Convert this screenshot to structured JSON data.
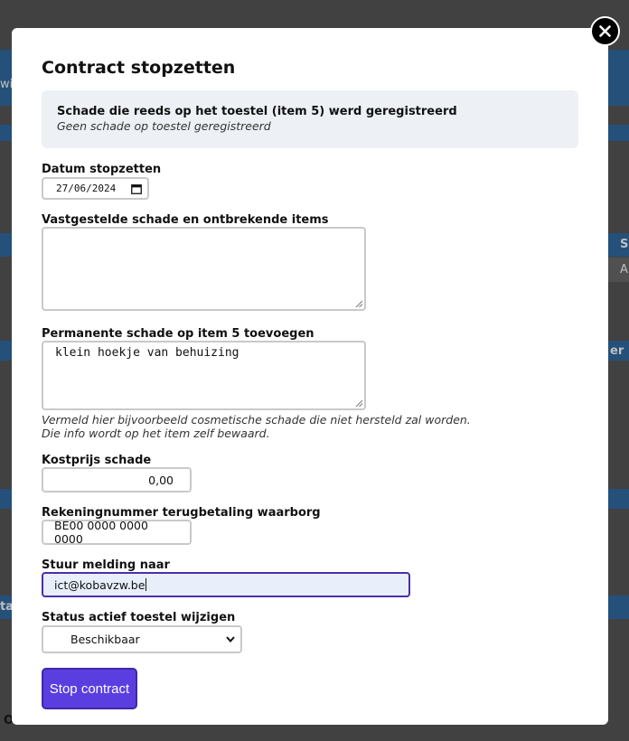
{
  "modal": {
    "title": "Contract stopzetten",
    "info": {
      "title": "Schade die reeds op het toestel (item 5) werd geregistreerd",
      "subtitle": "Geen schade op toestel geregistreerd"
    },
    "fields": {
      "stop_date": {
        "label": "Datum stopzetten",
        "value": "27/06/2024"
      },
      "damage": {
        "label": "Vastgestelde schade en ontbrekende items",
        "value": ""
      },
      "permanent_damage": {
        "label": "Permanente schade op item 5 toevoegen",
        "value": "klein hoekje van behuizing",
        "hint_line1": "Vermeld hier bijvoorbeeld cosmetische schade die niet hersteld zal worden.",
        "hint_line2": "Die info wordt op het item zelf bewaard."
      },
      "damage_cost": {
        "label": "Kostprijs schade",
        "value": "0,00"
      },
      "iban": {
        "label": "Rekeningnummer terugbetaling waarborg",
        "value": "BE00 0000 0000 0000"
      },
      "notify": {
        "label": "Stuur melding naar",
        "value": "ict@kobavzw.be"
      },
      "status": {
        "label": "Status actief toestel wijzigen",
        "selected": "Beschikbaar"
      }
    },
    "submit_label": "Stop contract"
  },
  "background": {
    "fragments": [
      "wi",
      "S",
      "A",
      "er",
      "ta"
    ],
    "footer_fragment": "O"
  },
  "icons": {
    "close": "close-icon",
    "calendar": "calendar-icon",
    "chevron": "chevron-down-icon"
  },
  "colors": {
    "primary": "#5b3ee0",
    "focus_border": "#4a2fa8",
    "info_bg": "#edf1f5"
  }
}
